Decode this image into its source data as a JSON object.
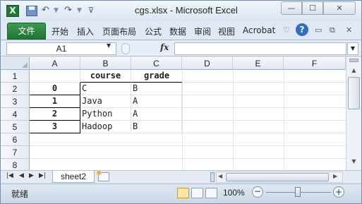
{
  "titlebar": {
    "app_icon_letter": "X",
    "title": "cgs.xlsx - Microsoft Excel",
    "undo_glyph": "↶",
    "redo_glyph": "↷",
    "sep_glyph": "▼",
    "custom_glyph": "⊽",
    "min_glyph": "—",
    "max_glyph": "☐",
    "close_glyph": "✕"
  },
  "ribbon": {
    "file_tab": "文件",
    "tabs": [
      "开始",
      "插入",
      "页面布局",
      "公式",
      "数据",
      "审阅",
      "视图",
      "Acrobat"
    ],
    "collapse_glyph": "♡",
    "help_glyph": "?",
    "min_glyph": "▭",
    "restore_glyph": "⧉",
    "close_glyph": "✕"
  },
  "formula_bar": {
    "name_box": "A1",
    "name_box_arrow": "▼",
    "fx": "fx",
    "formula": "",
    "expand_glyph": "▼"
  },
  "sheet": {
    "columns": [
      "A",
      "B",
      "C",
      "D",
      "E",
      "F"
    ],
    "rows": [
      "1",
      "2",
      "3",
      "4",
      "5",
      "6",
      "7",
      "8"
    ],
    "cells": {
      "B1": "course",
      "C1": "grade",
      "A2": "0",
      "B2": "C",
      "C2": "B",
      "A3": "1",
      "B3": "Java",
      "C3": "A",
      "A4": "2",
      "B4": "Python",
      "C4": "A",
      "A5": "3",
      "B5": "Hadoop",
      "C5": "B"
    }
  },
  "sheet_tabs": {
    "first_glyph": "|◀",
    "prev_glyph": "◀",
    "next_glyph": "▶",
    "last_glyph": "▶|",
    "active_tab": "sheet2"
  },
  "scroll": {
    "up_glyph": "▲",
    "down_glyph": "▼",
    "left_glyph": "◀",
    "right_glyph": "▶"
  },
  "status_bar": {
    "status": "就绪",
    "zoom": "100%",
    "zoom_out_glyph": "−",
    "zoom_in_glyph": "+",
    "zoom_level_fraction": 0.5
  },
  "colors": {
    "file_tab": "#1f7534",
    "help_icon": "#2f6fc1",
    "window_bg": "#dfe8f3"
  }
}
